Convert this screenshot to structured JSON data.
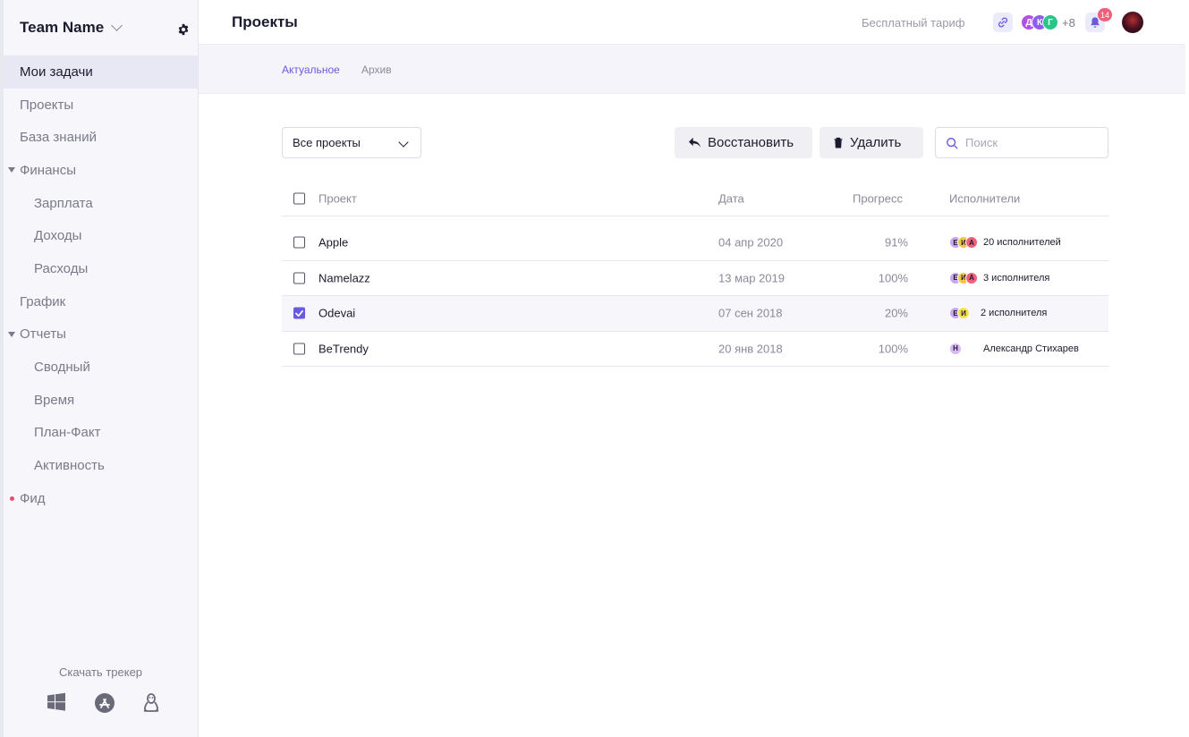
{
  "sidebar": {
    "team_name": "Team Name",
    "items": [
      {
        "label": "Мои задачи"
      },
      {
        "label": "Проекты"
      },
      {
        "label": "База знаний"
      },
      {
        "label": "Финансы"
      },
      {
        "label": "Зарплата"
      },
      {
        "label": "Доходы"
      },
      {
        "label": "Расходы"
      },
      {
        "label": "График"
      },
      {
        "label": "Отчеты"
      },
      {
        "label": "Сводный"
      },
      {
        "label": "Время"
      },
      {
        "label": "План-Факт"
      },
      {
        "label": "Активность"
      },
      {
        "label": "Фид"
      }
    ],
    "download_label": "Скачать трекер",
    "os_icons": [
      "windows-icon",
      "app-store-icon",
      "linux-icon"
    ]
  },
  "header": {
    "title": "Проекты",
    "tariff": "Бесплатный тариф",
    "team_avatars": [
      {
        "initial": "Д",
        "color": "#b44fe6"
      },
      {
        "initial": "К",
        "color": "#8e5cf0"
      },
      {
        "initial": "Г",
        "color": "#2bc58a"
      }
    ],
    "more_count": "+8",
    "notifications_count": "14"
  },
  "tabs": {
    "current": "Актуальное",
    "archive": "Архив"
  },
  "toolbar": {
    "filter_value": "Все проекты",
    "restore_label": "Восстановить",
    "delete_label": "Удалить",
    "search_placeholder": "Поиск"
  },
  "table": {
    "headers": {
      "project": "Проект",
      "date": "Дата",
      "progress": "Прогресс",
      "assignees": "Исполнители"
    },
    "rows": [
      {
        "name": "Apple",
        "date": "04 апр 2020",
        "progress": "91%",
        "assignees": "20 исполнителей",
        "checked": false,
        "avatars": [
          {
            "i": "Е",
            "c": "#c9a6f0"
          },
          {
            "i": "И",
            "c": "#f3c64a"
          },
          {
            "i": "А",
            "c": "#f0607a"
          }
        ]
      },
      {
        "name": "Namelazz",
        "date": "13 мар 2019",
        "progress": "100%",
        "assignees": "3 исполнителя",
        "checked": false,
        "avatars": [
          {
            "i": "Е",
            "c": "#c9a6f0"
          },
          {
            "i": "И",
            "c": "#f3c64a"
          },
          {
            "i": "А",
            "c": "#f0607a"
          }
        ]
      },
      {
        "name": "Odevai",
        "date": "07 сен 2018",
        "progress": "20%",
        "assignees": "2 исполнителя",
        "checked": true,
        "avatars": [
          {
            "i": "Е",
            "c": "#c9a6f0"
          },
          {
            "i": "И",
            "c": "#f3e04a"
          }
        ]
      },
      {
        "name": "BeTrendy",
        "date": "20 янв 2018",
        "progress": "100%",
        "assignees": "Александр Стихарев",
        "checked": false,
        "avatars": [
          {
            "i": "Н",
            "c": "#d9b8f5"
          }
        ]
      }
    ]
  },
  "colors": {
    "accent": "#6a5ae0",
    "badge": "#f0607a",
    "sidebar_bg": "#f6f6fb"
  }
}
